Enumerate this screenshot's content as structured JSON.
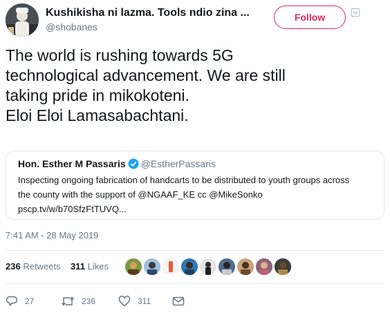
{
  "author": {
    "display_name": "Kushikisha ni lazma. Tools ndio zina ...",
    "handle": "@shobanes"
  },
  "follow_label": "Follow",
  "tweet": {
    "lines": [
      "The world is rushing towards 5G",
      "technological advancement. We are still",
      "taking pride in mikokoteni.",
      "Eloi Eloi Lamasabachtani."
    ]
  },
  "quoted_tweet": {
    "display_name": "Hon. Esther M Passaris",
    "handle": "@EstherPassaris",
    "lines": [
      "Inspecting ongoing fabrication of handcarts to be distributed to youth groups across",
      "the county with the support of @NGAAF_KE cc @MikeSonko",
      "pscp.tv/w/b70SfzFtTUVQ..."
    ]
  },
  "timestamp": "7:41 AM - 28 May 2019",
  "stats": {
    "retweets_count": "236",
    "retweets_label": "Retweets",
    "likes_count": "311",
    "likes_label": "Likes"
  },
  "actions": {
    "replies": "27",
    "retweets": "236",
    "likes": "311"
  },
  "colors": {
    "follow_accent": "#e0245e",
    "verified": "#1da1f2",
    "muted_text": "#657786"
  },
  "icons": [
    "verified-icon",
    "reply-icon",
    "retweet-icon",
    "like-icon",
    "message-icon",
    "caret-down-icon"
  ]
}
